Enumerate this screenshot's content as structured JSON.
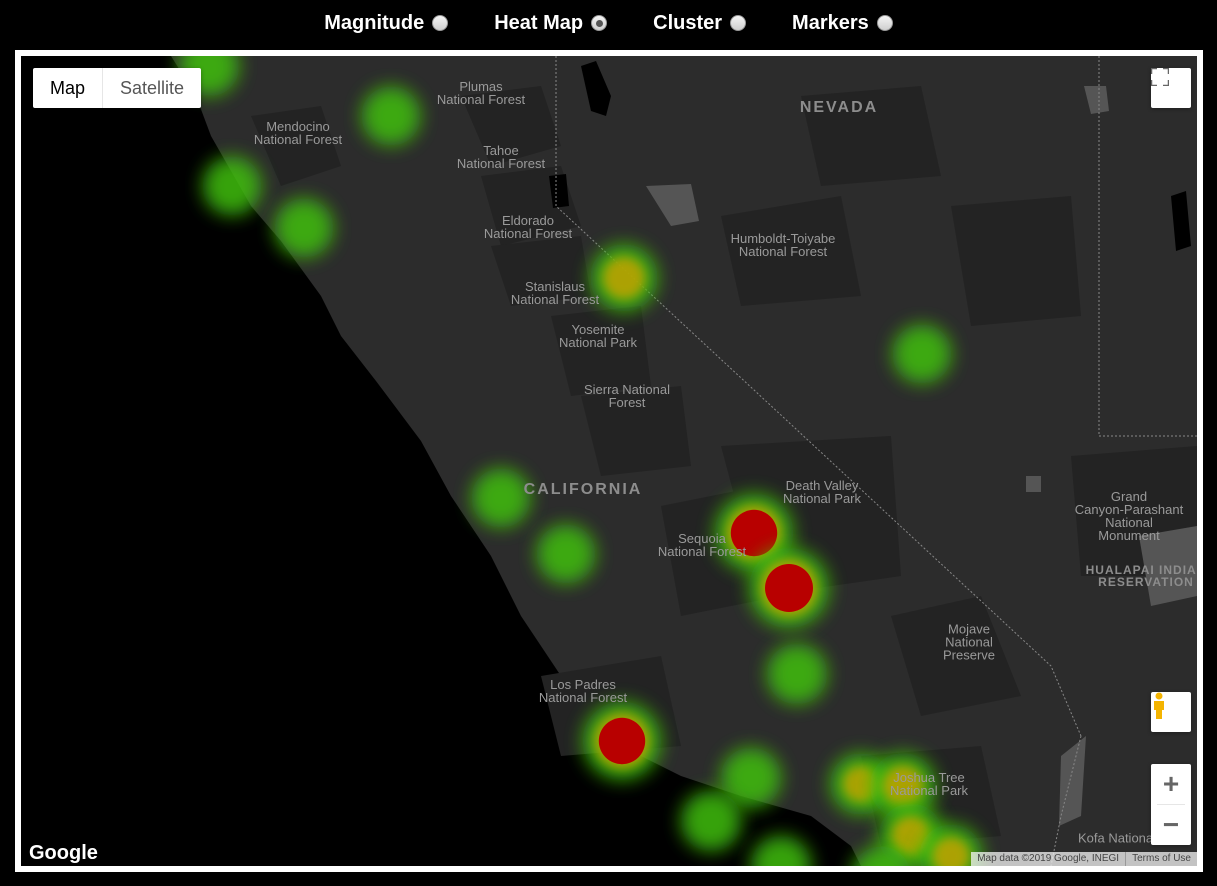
{
  "top_options": [
    {
      "label": "Magnitude",
      "checked": false
    },
    {
      "label": "Heat Map",
      "checked": true
    },
    {
      "label": "Cluster",
      "checked": false
    },
    {
      "label": "Markers",
      "checked": false
    }
  ],
  "map_type": {
    "map": "Map",
    "satellite": "Satellite"
  },
  "map_labels": {
    "states": [
      "NEVADA",
      "CALIFORNIA"
    ],
    "places": [
      "Plumas\nNational Forest",
      "Mendocino\nNational Forest",
      "Tahoe\nNational Forest",
      "Eldorado\nNational Forest",
      "Humboldt-Toiyabe\nNational Forest",
      "Stanislaus\nNational Forest",
      "Yosemite\nNational Park",
      "Sierra National\nForest",
      "Death Valley\nNational Park",
      "Grand\nCanyon-Parashant\nNational\nMonument",
      "Sequoia\nNational Forest",
      "Mojave\nNational\nPreserve",
      "Los Padres\nNational Forest",
      "Joshua Tree\nNational Park",
      "Kofa National"
    ],
    "reservation": "HUALAPAI INDIAN\nRESERVATION"
  },
  "heat_points": [
    {
      "intensity": 0.3
    },
    {
      "intensity": 0.25
    },
    {
      "intensity": 0.25
    },
    {
      "intensity": 0.25
    },
    {
      "intensity": 0.55
    },
    {
      "intensity": 0.25
    },
    {
      "intensity": 0.25
    },
    {
      "intensity": 0.25
    },
    {
      "intensity": 0.95
    },
    {
      "intensity": 1.0
    },
    {
      "intensity": 0.3
    },
    {
      "intensity": 0.95
    },
    {
      "intensity": 0.3
    },
    {
      "intensity": 0.3
    },
    {
      "intensity": 0.35
    },
    {
      "intensity": 0.5
    },
    {
      "intensity": 0.45
    },
    {
      "intensity": 0.4
    },
    {
      "intensity": 0.3
    },
    {
      "intensity": 0.25
    }
  ],
  "colors": {
    "low": "#3fbf10",
    "mid": "#c8a000",
    "high": "#b80000",
    "land": "#2c2c2c",
    "water": "#000000",
    "park": "#232323"
  },
  "icons": {
    "fullscreen": "fullscreen-icon",
    "pegman": "pegman-icon",
    "zoom_in": "plus-icon",
    "zoom_out": "minus-icon"
  },
  "footer": {
    "logo": "Google",
    "map_data": "Map data ©2019 Google, INEGI",
    "terms": "Terms of Use"
  }
}
